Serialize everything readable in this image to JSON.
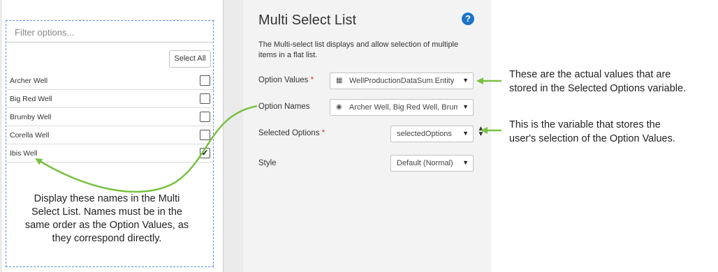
{
  "canvas": {
    "filter_placeholder": "Filter options...",
    "select_all_label": "Select All",
    "options": [
      {
        "label": "Archer Well",
        "checked": false
      },
      {
        "label": "Big Red Well",
        "checked": false
      },
      {
        "label": "Brumby Well",
        "checked": false
      },
      {
        "label": "Corella Well",
        "checked": false
      },
      {
        "label": "Ibis Well",
        "checked": true
      }
    ]
  },
  "panel": {
    "title": "Multi Select List",
    "help_icon": "question-circle-icon",
    "description": "The Multi-select list displays and allow selection of multiple items in a flat list.",
    "properties": {
      "option_values": {
        "label": "Option Values",
        "required_mark": "*",
        "value": "WellProductionDataSum.Entity",
        "icon": "table-icon"
      },
      "option_names": {
        "label": "Option Names",
        "value": "Archer Well, Big Red Well, Brum...",
        "icon": "radio-icon"
      },
      "selected_options": {
        "label": "Selected Options",
        "required_mark": "*",
        "value": "selectedOptions"
      },
      "style": {
        "label": "Style",
        "value": "Default (Normal)"
      }
    }
  },
  "annotations": {
    "option_values_note": [
      "These are the actual values that are",
      "stored in the Selected Options variable."
    ],
    "selected_options_note": [
      "This is the variable that stores the",
      "user's selection of the Option Values."
    ],
    "option_names_note": [
      "Display these names in the Multi",
      "Select List. Names must be in the",
      "same order as the Option Values, as",
      "they correspond directly."
    ],
    "arrow_color": "#7ac143"
  }
}
